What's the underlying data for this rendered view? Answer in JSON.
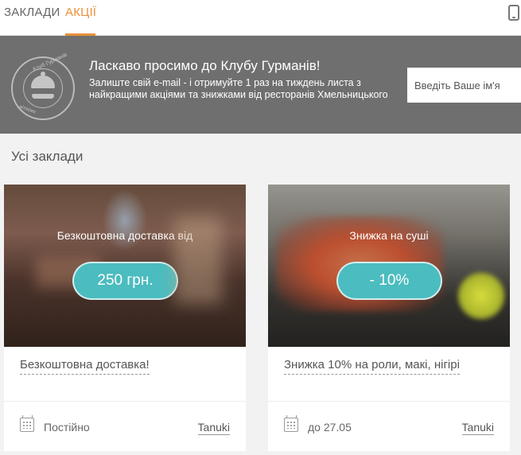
{
  "nav": {
    "tabs": [
      {
        "label": "ЗАКЛАДИ"
      },
      {
        "label": "АКЦІЇ",
        "active": true
      }
    ],
    "device_icon": "phone-icon",
    "accent_color": "#e8913a"
  },
  "banner": {
    "logo_text_top": "Клуб Гурманів",
    "logo_text_bottom": "вітаємо",
    "title": "Ласкаво просимо до Клубу Гурманів!",
    "text": "Залиште свій e-mail - і отримуйте 1 раз на тиждень листа з найкращими акціями та знижками від ресторанів Хмельницького",
    "input_placeholder": "Введіть Ваше ім'я"
  },
  "section": {
    "title": "Усі заклади"
  },
  "cards": [
    {
      "caption": "Безкоштовна доставка від",
      "badge": "250 грн.",
      "title": "Безкоштовна доставка!",
      "date": "Постійно",
      "place": "Tanuki"
    },
    {
      "caption": "Знижка на суші",
      "badge": "- 10%",
      "title": "Знижка 10% на роли, макі, нігірі",
      "date": "до 27.05",
      "place": "Tanuki"
    }
  ],
  "colors": {
    "badge": "#4bbcbf",
    "banner": "#6f6f6f"
  }
}
